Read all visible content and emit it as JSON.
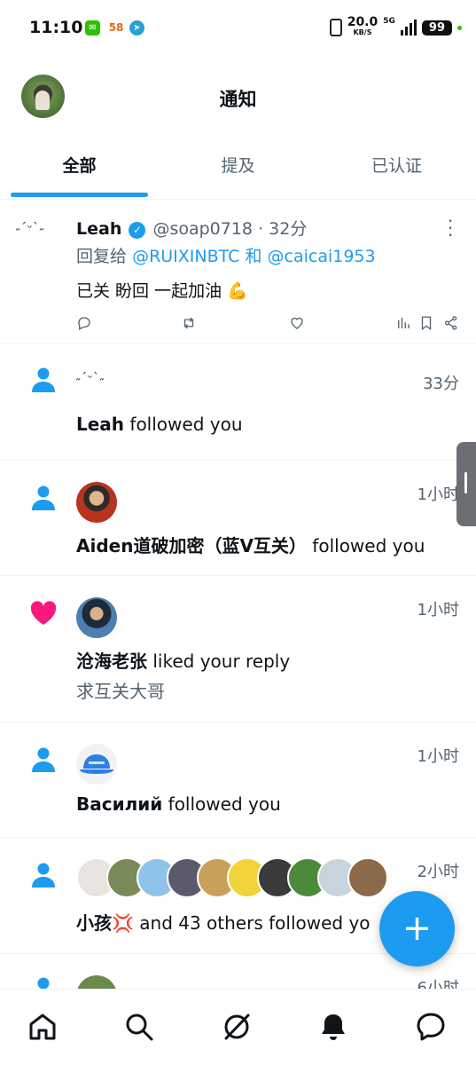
{
  "status_bar": {
    "time": "11:10",
    "app_58": "58",
    "net_speed": "20.0",
    "net_unit": "KB/S",
    "network": "5G",
    "battery": "99"
  },
  "header": {
    "title": "通知"
  },
  "tabs": [
    {
      "label": "全部",
      "active": true
    },
    {
      "label": "提及",
      "active": false
    },
    {
      "label": "已认证",
      "active": false
    }
  ],
  "reply_tweet": {
    "avatar_text": "˶ˊᵕˋ˶",
    "name": "Leah",
    "handle": "@soap0718",
    "time": "· 32分",
    "reply_prefix": "回复给",
    "mention_1": "@RUIXINBTC",
    "reply_join": "和",
    "mention_2": "@caicai1953",
    "text": "已关 盼回 一起加油 💪"
  },
  "notifications": [
    {
      "type": "follow",
      "icon": "person-icon",
      "avatar_text": "˶ˊᵕˋ˶",
      "name": "Leah",
      "action": "followed you",
      "time": "33分"
    },
    {
      "type": "follow",
      "icon": "person-icon",
      "name": "Aiden道破加密（蓝V互关）",
      "action": "followed you",
      "time": "1小时"
    },
    {
      "type": "like",
      "icon": "heart-icon",
      "name": "沧海老张",
      "action": "liked your reply",
      "quote": "求互关大哥",
      "time": "1小时"
    },
    {
      "type": "follow",
      "icon": "person-icon",
      "name": "Василий",
      "action": "followed you",
      "time": "1小时"
    },
    {
      "type": "follow",
      "icon": "person-icon",
      "name": "小孩💢",
      "action": "and 43 others followed yo",
      "time": "2小时"
    },
    {
      "type": "follow",
      "icon": "person-icon",
      "time": "6小时"
    }
  ],
  "fab": {
    "label": "+"
  },
  "colors": {
    "accent": "#1d9bf0",
    "like": "#f91880",
    "text": "#0f1419",
    "secondary": "#536471"
  },
  "bottom_nav": [
    "home-icon",
    "search-icon",
    "grok-icon",
    "notifications-icon",
    "messages-icon"
  ]
}
